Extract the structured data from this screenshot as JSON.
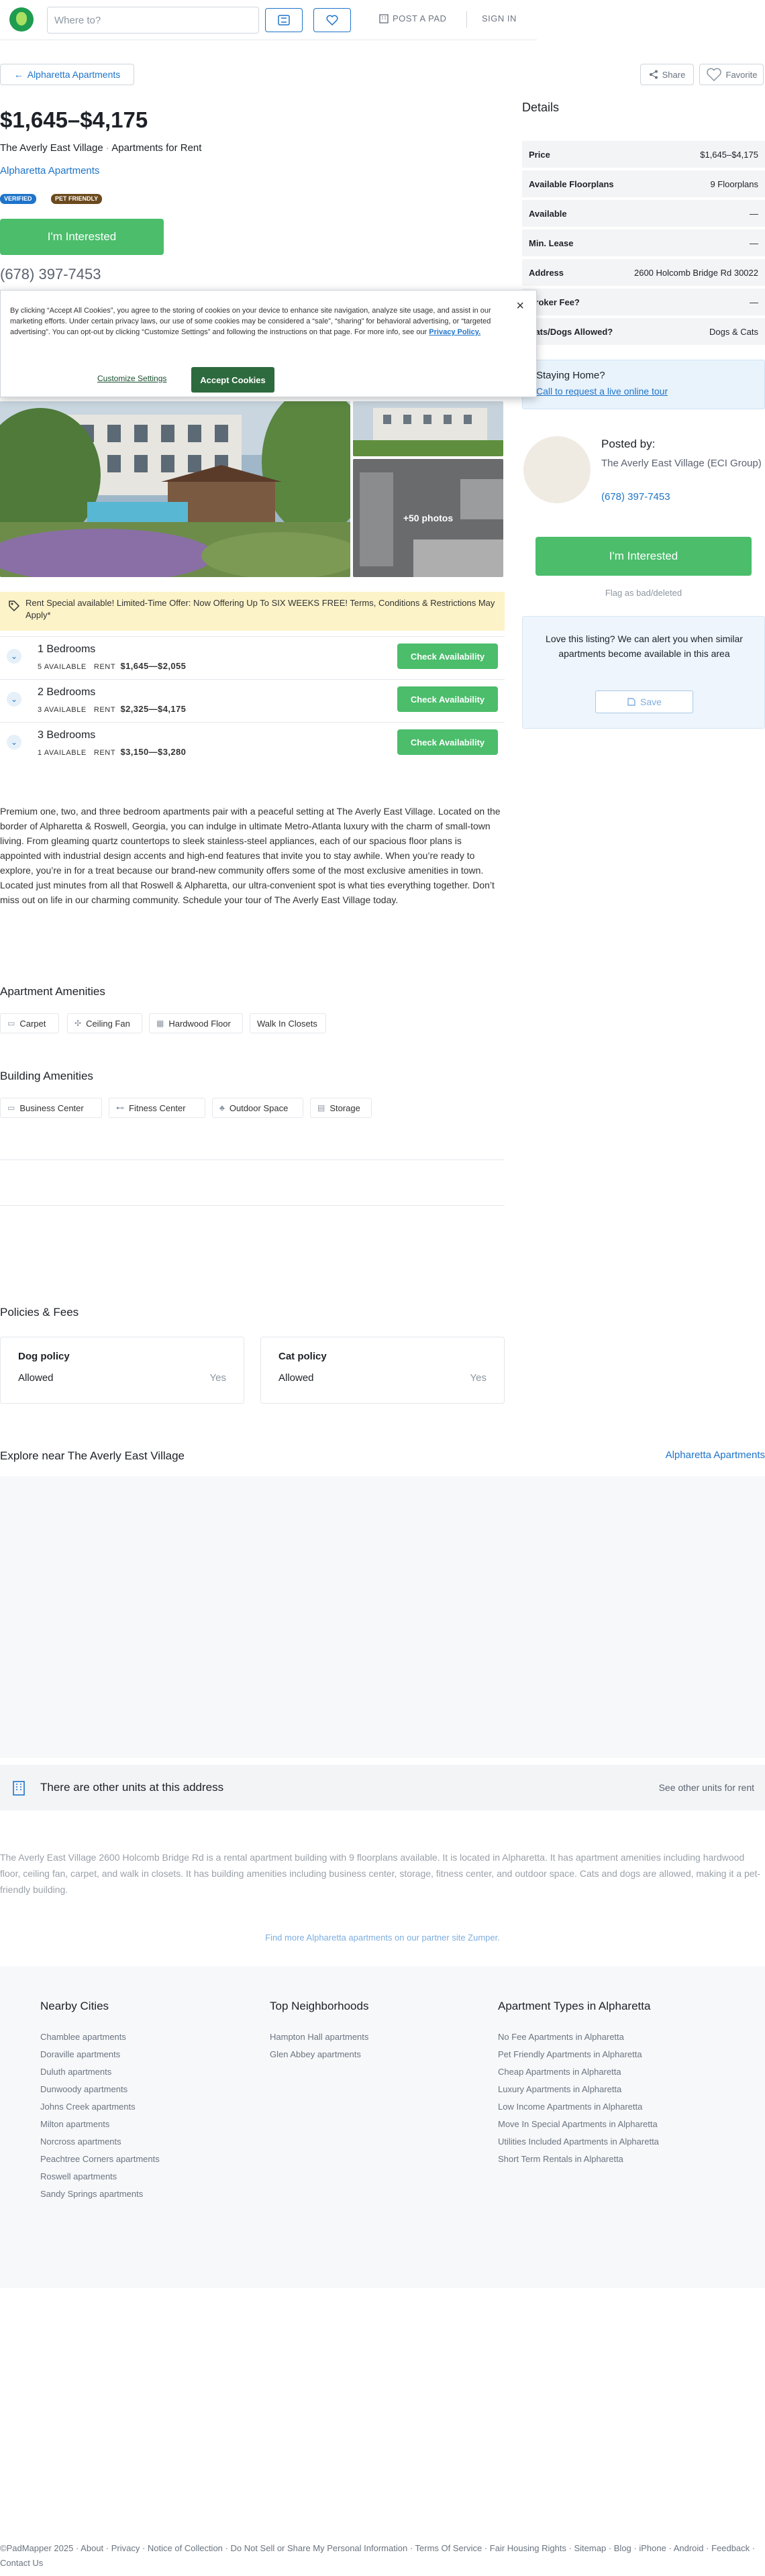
{
  "header": {
    "search_placeholder": "Where to?",
    "post_a_pad": "POST A PAD",
    "sign_in": "SIGN IN"
  },
  "breadcrumb": {
    "back_label": "Alpharetta Apartments"
  },
  "actions": {
    "share": "Share",
    "favorite": "Favorite"
  },
  "listing": {
    "price": "$1,645–$4,175",
    "name": "The Averly East Village",
    "type": "Apartments for Rent",
    "sep": "·",
    "city_link": "Alpharetta Apartments",
    "badges": [
      "VERIFIED",
      "PET FRIENDLY"
    ],
    "interested": "I'm Interested",
    "phone": "(678) 397-7453"
  },
  "cookie": {
    "text": "By clicking “Accept All Cookies”, you agree to the storing of cookies on your device to enhance site navigation, analyze site usage, and assist in our marketing efforts. Under certain privacy laws, our use of some cookies may be considered a “sale”, “sharing” for behavioral advertising, or “targeted advertising”. You can opt-out by clicking “Customize Settings” and following the instructions on that page. For more info, see our",
    "policy_link": "Privacy Policy.",
    "customize": "Customize Settings",
    "accept": "Accept Cookies",
    "close": "×"
  },
  "photos": {
    "more": "+50 photos"
  },
  "special": "Rent Special available! Limited-Time Offer: Now Offering Up To SIX WEEKS FREE! Terms, Conditions & Restrictions May Apply*",
  "units": [
    {
      "name": "1 Bedrooms",
      "available": "5 AVAILABLE",
      "rent_label": "RENT",
      "rent": "$1,645—$2,055",
      "button": "Check Availability"
    },
    {
      "name": "2 Bedrooms",
      "available": "3 AVAILABLE",
      "rent_label": "RENT",
      "rent": "$2,325—$4,175",
      "button": "Check Availability"
    },
    {
      "name": "3 Bedrooms",
      "available": "1 AVAILABLE",
      "rent_label": "RENT",
      "rent": "$3,150—$3,280",
      "button": "Check Availability"
    }
  ],
  "description": "Premium one, two, and three bedroom apartments pair with a peaceful setting at The Averly East Village. Located on the border of Alpharetta & Roswell, Georgia, you can indulge in ultimate Metro-Atlanta luxury with the charm of small-town living. From gleaming quartz countertops to sleek stainless-steel appliances, each of our spacious floor plans is appointed with industrial design accents and high-end features that invite you to stay awhile. When you’re ready to explore, you’re in for a treat because our brand-new community offers some of the most exclusive amenities in town. Located just minutes from all that Roswell & Alpharetta, our ultra-convenient spot is what ties everything together. Don’t miss out on life in our charming community. Schedule your tour of The Averly East Village today.",
  "apartment_amenities": {
    "title": "Apartment Amenities",
    "items": [
      "Carpet",
      "Ceiling Fan",
      "Hardwood Floor",
      "Walk In Closets"
    ]
  },
  "building_amenities": {
    "title": "Building Amenities",
    "items": [
      "Business Center",
      "Fitness Center",
      "Outdoor Space",
      "Storage"
    ]
  },
  "policies": {
    "title": "Policies & Fees",
    "dog": {
      "title": "Dog policy",
      "label": "Allowed",
      "value": "Yes"
    },
    "cat": {
      "title": "Cat policy",
      "label": "Allowed",
      "value": "Yes"
    }
  },
  "explore": {
    "title": "Explore near The Averly East Village",
    "link": "Alpharetta Apartments"
  },
  "other_units": {
    "text": "There are other units at this address",
    "link": "See other units for rent"
  },
  "summary": "The Averly East Village 2600 Holcomb Bridge Rd is a rental apartment building with 9 floorplans available. It is located in Alpharetta. It has apartment amenities including hardwood floor, ceiling fan, carpet, and walk in closets. It has building amenities including business center, storage, fitness center, and outdoor space. Cats and dogs are allowed, making it a pet-friendly building.",
  "zumper_link": "Find more Alpharetta apartments on our partner site Zumper.",
  "details": {
    "title": "Details",
    "rows": [
      {
        "label": "Price",
        "value": "$1,645–$4,175"
      },
      {
        "label": "Available Floorplans",
        "value": "9 Floorplans"
      },
      {
        "label": "Available",
        "value": "—"
      },
      {
        "label": "Min. Lease",
        "value": "—"
      },
      {
        "label": "Address",
        "value": "2600 Holcomb Bridge Rd 30022"
      },
      {
        "label": "Broker Fee?",
        "value": "—"
      },
      {
        "label": "Cats/Dogs Allowed?",
        "value": "Dogs & Cats"
      }
    ]
  },
  "tour": {
    "title": "Staying Home?",
    "link": "Call to request a live online tour"
  },
  "posted": {
    "title": "Posted by:",
    "name": "The Averly East Village (ECI Group)",
    "phone": "(678) 397-7453"
  },
  "sidebar": {
    "interested": "I'm Interested",
    "flag": "Flag as bad/deleted",
    "alert_text": "Love this listing? We can alert you when similar apartments become available in this area",
    "save": "Save"
  },
  "footer": {
    "nearby": {
      "title": "Nearby Cities",
      "items": [
        "Chamblee apartments",
        "Doraville apartments",
        "Duluth apartments",
        "Dunwoody apartments",
        "Johns Creek apartments",
        "Milton apartments",
        "Norcross apartments",
        "Peachtree Corners apartments",
        "Roswell apartments",
        "Sandy Springs apartments"
      ]
    },
    "neighborhoods": {
      "title": "Top Neighborhoods",
      "items": [
        "Hampton Hall apartments",
        "Glen Abbey apartments"
      ]
    },
    "types": {
      "title": "Apartment Types in Alpharetta",
      "items": [
        "No Fee Apartments in Alpharetta",
        "Pet Friendly Apartments in Alpharetta",
        "Cheap Apartments in Alpharetta",
        "Luxury Apartments in Alpharetta",
        "Low Income Apartments in Alpharetta",
        "Move In Special Apartments in Alpharetta",
        "Utilities Included Apartments in Alpharetta",
        "Short Term Rentals in Alpharetta"
      ]
    },
    "links": [
      "©PadMapper 2025",
      "About",
      "Privacy",
      "Notice of Collection",
      "Do Not Sell or Share My Personal Information",
      "Terms Of Service",
      "Fair Housing Rights",
      "Sitemap",
      "Blog",
      "iPhone",
      "Android",
      "Feedback",
      "Contact Us"
    ]
  }
}
